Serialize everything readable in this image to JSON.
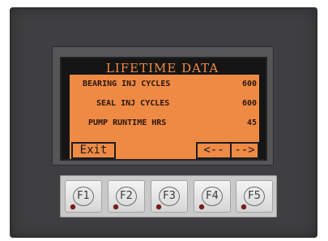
{
  "screen": {
    "title": "LIFETIME DATA",
    "rows": [
      {
        "label": "BEARING INJ CYCLES",
        "value": "600"
      },
      {
        "label": "SEAL INJ CYCLES",
        "value": "600"
      },
      {
        "label": "PUMP RUNTIME HRS",
        "value": "45"
      }
    ],
    "exit_label": "Exit",
    "prev_label": "<--",
    "next_label": "-->"
  },
  "keypad": {
    "keys": [
      "F1",
      "F2",
      "F3",
      "F4",
      "F5"
    ]
  },
  "colors": {
    "lcd_orange": "#ef8a45",
    "lcd_dark": "#151515",
    "housing": "#3f3f41",
    "led": "#7a1c14"
  }
}
